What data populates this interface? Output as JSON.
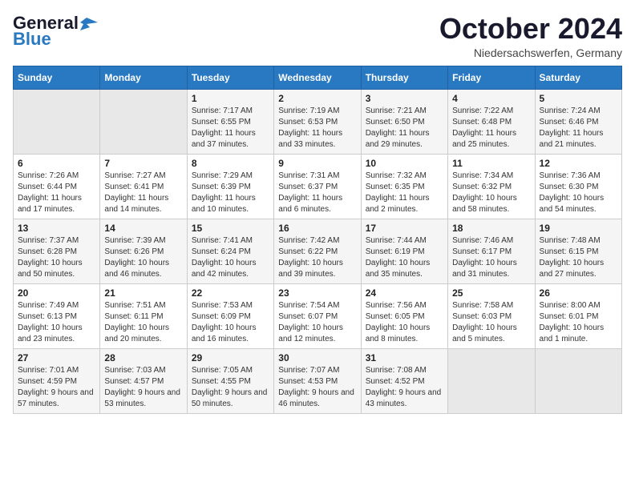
{
  "header": {
    "logo_line1": "General",
    "logo_line2": "Blue",
    "month_title": "October 2024",
    "location": "Niedersachswerfen, Germany"
  },
  "weekdays": [
    "Sunday",
    "Monday",
    "Tuesday",
    "Wednesday",
    "Thursday",
    "Friday",
    "Saturday"
  ],
  "weeks": [
    [
      {
        "day": "",
        "info": ""
      },
      {
        "day": "",
        "info": ""
      },
      {
        "day": "1",
        "info": "Sunrise: 7:17 AM\nSunset: 6:55 PM\nDaylight: 11 hours and 37 minutes."
      },
      {
        "day": "2",
        "info": "Sunrise: 7:19 AM\nSunset: 6:53 PM\nDaylight: 11 hours and 33 minutes."
      },
      {
        "day": "3",
        "info": "Sunrise: 7:21 AM\nSunset: 6:50 PM\nDaylight: 11 hours and 29 minutes."
      },
      {
        "day": "4",
        "info": "Sunrise: 7:22 AM\nSunset: 6:48 PM\nDaylight: 11 hours and 25 minutes."
      },
      {
        "day": "5",
        "info": "Sunrise: 7:24 AM\nSunset: 6:46 PM\nDaylight: 11 hours and 21 minutes."
      }
    ],
    [
      {
        "day": "6",
        "info": "Sunrise: 7:26 AM\nSunset: 6:44 PM\nDaylight: 11 hours and 17 minutes."
      },
      {
        "day": "7",
        "info": "Sunrise: 7:27 AM\nSunset: 6:41 PM\nDaylight: 11 hours and 14 minutes."
      },
      {
        "day": "8",
        "info": "Sunrise: 7:29 AM\nSunset: 6:39 PM\nDaylight: 11 hours and 10 minutes."
      },
      {
        "day": "9",
        "info": "Sunrise: 7:31 AM\nSunset: 6:37 PM\nDaylight: 11 hours and 6 minutes."
      },
      {
        "day": "10",
        "info": "Sunrise: 7:32 AM\nSunset: 6:35 PM\nDaylight: 11 hours and 2 minutes."
      },
      {
        "day": "11",
        "info": "Sunrise: 7:34 AM\nSunset: 6:32 PM\nDaylight: 10 hours and 58 minutes."
      },
      {
        "day": "12",
        "info": "Sunrise: 7:36 AM\nSunset: 6:30 PM\nDaylight: 10 hours and 54 minutes."
      }
    ],
    [
      {
        "day": "13",
        "info": "Sunrise: 7:37 AM\nSunset: 6:28 PM\nDaylight: 10 hours and 50 minutes."
      },
      {
        "day": "14",
        "info": "Sunrise: 7:39 AM\nSunset: 6:26 PM\nDaylight: 10 hours and 46 minutes."
      },
      {
        "day": "15",
        "info": "Sunrise: 7:41 AM\nSunset: 6:24 PM\nDaylight: 10 hours and 42 minutes."
      },
      {
        "day": "16",
        "info": "Sunrise: 7:42 AM\nSunset: 6:22 PM\nDaylight: 10 hours and 39 minutes."
      },
      {
        "day": "17",
        "info": "Sunrise: 7:44 AM\nSunset: 6:19 PM\nDaylight: 10 hours and 35 minutes."
      },
      {
        "day": "18",
        "info": "Sunrise: 7:46 AM\nSunset: 6:17 PM\nDaylight: 10 hours and 31 minutes."
      },
      {
        "day": "19",
        "info": "Sunrise: 7:48 AM\nSunset: 6:15 PM\nDaylight: 10 hours and 27 minutes."
      }
    ],
    [
      {
        "day": "20",
        "info": "Sunrise: 7:49 AM\nSunset: 6:13 PM\nDaylight: 10 hours and 23 minutes."
      },
      {
        "day": "21",
        "info": "Sunrise: 7:51 AM\nSunset: 6:11 PM\nDaylight: 10 hours and 20 minutes."
      },
      {
        "day": "22",
        "info": "Sunrise: 7:53 AM\nSunset: 6:09 PM\nDaylight: 10 hours and 16 minutes."
      },
      {
        "day": "23",
        "info": "Sunrise: 7:54 AM\nSunset: 6:07 PM\nDaylight: 10 hours and 12 minutes."
      },
      {
        "day": "24",
        "info": "Sunrise: 7:56 AM\nSunset: 6:05 PM\nDaylight: 10 hours and 8 minutes."
      },
      {
        "day": "25",
        "info": "Sunrise: 7:58 AM\nSunset: 6:03 PM\nDaylight: 10 hours and 5 minutes."
      },
      {
        "day": "26",
        "info": "Sunrise: 8:00 AM\nSunset: 6:01 PM\nDaylight: 10 hours and 1 minute."
      }
    ],
    [
      {
        "day": "27",
        "info": "Sunrise: 7:01 AM\nSunset: 4:59 PM\nDaylight: 9 hours and 57 minutes."
      },
      {
        "day": "28",
        "info": "Sunrise: 7:03 AM\nSunset: 4:57 PM\nDaylight: 9 hours and 53 minutes."
      },
      {
        "day": "29",
        "info": "Sunrise: 7:05 AM\nSunset: 4:55 PM\nDaylight: 9 hours and 50 minutes."
      },
      {
        "day": "30",
        "info": "Sunrise: 7:07 AM\nSunset: 4:53 PM\nDaylight: 9 hours and 46 minutes."
      },
      {
        "day": "31",
        "info": "Sunrise: 7:08 AM\nSunset: 4:52 PM\nDaylight: 9 hours and 43 minutes."
      },
      {
        "day": "",
        "info": ""
      },
      {
        "day": "",
        "info": ""
      }
    ]
  ]
}
